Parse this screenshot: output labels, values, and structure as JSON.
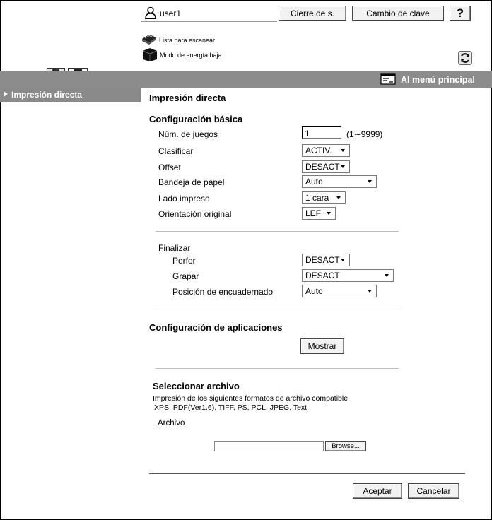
{
  "header": {
    "user_name": "user1",
    "logout_label": "Cierre de s.",
    "change_password_label": "Cambio de clave",
    "help_label": "?"
  },
  "status": {
    "scan_list_label": "Lista para escanear",
    "low_power_label": "Modo de energía baja"
  },
  "nav": {
    "main_menu_label": "Al menú principal"
  },
  "sidebar": {
    "items": [
      {
        "label": "Impresión directa"
      }
    ]
  },
  "main": {
    "page_title": "Impresión directa",
    "basic_title": "Configuración básica",
    "copies": {
      "label": "Núm. de juegos",
      "value": "1",
      "range": "(1∼9999)"
    },
    "sort": {
      "label": "Clasificar",
      "value": "ACTIV."
    },
    "offset": {
      "label": "Offset",
      "value": "DESACT"
    },
    "paper_tray": {
      "label": "Bandeja de papel",
      "value": "Auto"
    },
    "print_side": {
      "label": "Lado impreso",
      "value": "1 cara"
    },
    "orientation": {
      "label": "Orientación original",
      "value": "LEF"
    },
    "finish": {
      "label": "Finalizar",
      "punch": {
        "label": "Perfor",
        "value": "DESACT"
      },
      "staple": {
        "label": "Grapar",
        "value": "DESACT"
      },
      "binding": {
        "label": "Posición de encuadernado",
        "value": "Auto"
      }
    },
    "app_title": "Configuración de aplicaciones",
    "show_label": "Mostrar",
    "file_title": "Seleccionar archivo",
    "file_desc1": "Impresión de los siguientes formatos de archivo compatible.",
    "file_desc2": "XPS, PDF(Ver1.6), TIFF, PS, PCL, JPEG, Text",
    "file_label": "Archivo",
    "file_value": "",
    "browse_label": "Browse...",
    "ok_label": "Aceptar",
    "cancel_label": "Cancelar"
  }
}
